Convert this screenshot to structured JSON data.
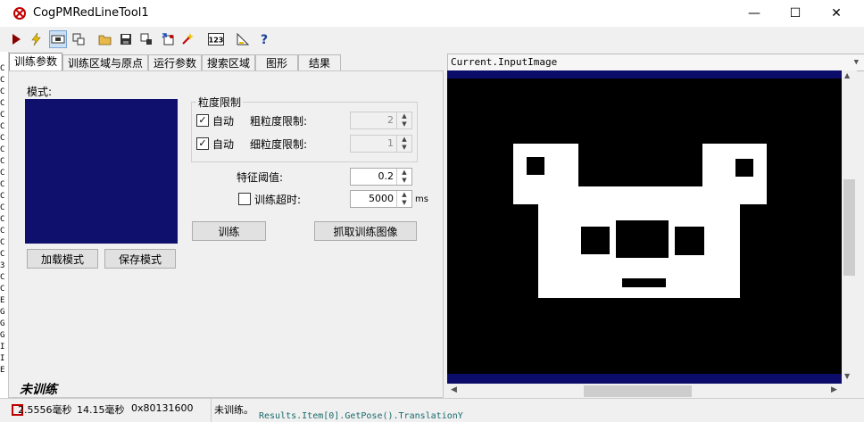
{
  "window": {
    "title": "CogPMRedLineTool1",
    "minimize": "—",
    "maximize": "☐",
    "close": "✕"
  },
  "toolbar": {
    "icons": [
      "run-icon",
      "lightning-icon",
      "display-icon",
      "region-icon",
      "open-folder-icon",
      "save-icon",
      "grab-icon",
      "reset-icon",
      "wand-icon",
      "numeric-icon",
      "measure-icon",
      "help-icon"
    ],
    "numeric_label": "123"
  },
  "left_strip": [
    "C",
    "C",
    "C",
    "C",
    "C",
    "C",
    "C",
    "C",
    "C",
    "C",
    "C",
    "C",
    "C",
    "C",
    "C",
    "C",
    "C",
    "3",
    "C",
    "C",
    "E",
    "G",
    "G",
    "G",
    "I",
    "I",
    "E"
  ],
  "tabs": [
    "训练参数",
    "训练区域与原点",
    "运行参数",
    "搜索区域",
    "图形",
    "结果"
  ],
  "train": {
    "pattern_label": "模式:",
    "load_button": "加载模式",
    "save_button": "保存模式",
    "granularity_group": "粒度限制",
    "coarse_auto": "自动",
    "coarse_label": "粗粒度限制:",
    "coarse_value": "2",
    "fine_auto": "自动",
    "fine_label": "细粒度限制:",
    "fine_value": "1",
    "threshold_label": "特征阈值:",
    "threshold_value": "0.2",
    "timeout_label": "训练超时:",
    "timeout_value": "5000",
    "timeout_unit": "ms",
    "train_button": "训练",
    "grab_button": "抓取训练图像",
    "status": "未训练"
  },
  "image": {
    "header": "Current.InputImage"
  },
  "statusbar": {
    "time1": "2.5556毫秒",
    "time2": "14.15毫秒",
    "code": "0x80131600",
    "message": "未训练。",
    "code_line": "Results.Item[0].GetPose().TranslationY"
  },
  "colors": {
    "pattern_bg": "#0f0f6e",
    "image_border": "#0b0b6a",
    "accent_red": "#c00000"
  }
}
